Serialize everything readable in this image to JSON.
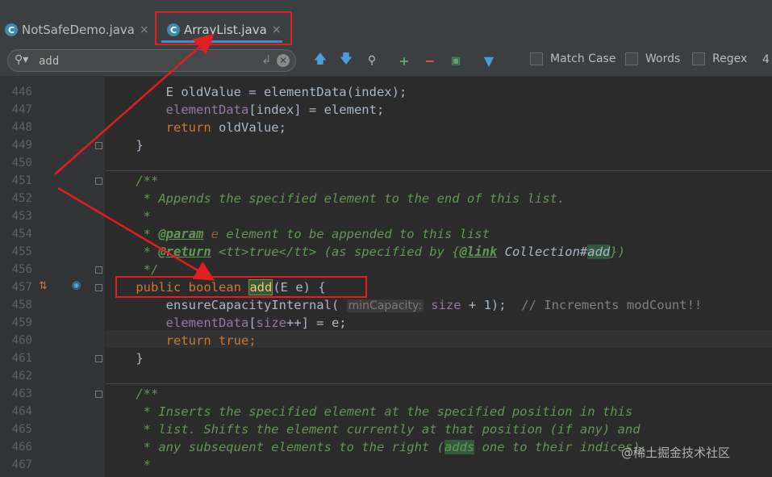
{
  "tabs": [
    {
      "label": "NotSafeDemo.java",
      "icon": "java-class-icon",
      "active": false
    },
    {
      "label": "ArrayList.java",
      "icon": "java-class-locked-icon",
      "active": true
    }
  ],
  "search": {
    "query": "add",
    "match_case_label": "Match Case",
    "words_label": "Words",
    "regex_label": "Regex",
    "count": "4"
  },
  "toolbar_icons": [
    "previous-occurrence-icon",
    "next-occurrence-icon",
    "find-all-icon",
    "add-occurrence-icon",
    "remove-occurrence-icon",
    "select-all-occurrences-icon",
    "filter-icon"
  ],
  "line_numbers": [
    "446",
    "447",
    "448",
    "449",
    "450",
    "451",
    "452",
    "453",
    "454",
    "455",
    "456",
    "457",
    "458",
    "459",
    "460",
    "461",
    "462",
    "463",
    "464",
    "465",
    "466",
    "467"
  ],
  "code": {
    "l446_pre": "        E oldValue = elementData(index);",
    "l447_field": "elementData",
    "l447_rest": "[index] = element;",
    "l448_kw": "return",
    "l448_rest": " oldValue;",
    "l449": "    }",
    "l451": "    /**",
    "l452": "     * Appends the specified element to the end of this list.",
    "l453": "     *",
    "l454_tag": "@param",
    "l454_rest": " element to be appended to this list",
    "l455_tag": "@return",
    "l455_mid": " <tt>true</tt> (as specified by {",
    "l455_link": "@link",
    "l455_ref": " Collection#",
    "l455_add": "add",
    "l455_end": "})",
    "l456": "     */",
    "l457_kw": "public boolean",
    "l457_name": "add",
    "l457_rest": "(E e) {",
    "l458_pre": "ensureCapacityInternal(",
    "l458_hint": "minCapacity:",
    "l458_field": "size",
    "l458_rest": " + 1);",
    "l458_comment": "// Increments modCount!!",
    "l459_field": "elementData",
    "l459_mid": "[",
    "l459_size": "size",
    "l459_rest": "++] = e;",
    "l460_kw": "return true",
    "l460_rest": ";",
    "l461": "    }",
    "l463": "    /**",
    "l464": "     * Inserts the specified element at the specified position in this",
    "l465": "     * list. Shifts the element currently at that position (if any) and",
    "l466_pre": "     * any subsequent elements to the right (",
    "l466_add": "adds",
    "l466_post": " one to their indices).",
    "l467": "     *"
  },
  "watermark": "@稀土掘金技术社区",
  "colors": {
    "background": "#2B2B2B",
    "keyword": "#CC7832",
    "doc_comment": "#629755",
    "field": "#9876AA",
    "number": "#6897BB",
    "annotation_box": "#E02020"
  }
}
